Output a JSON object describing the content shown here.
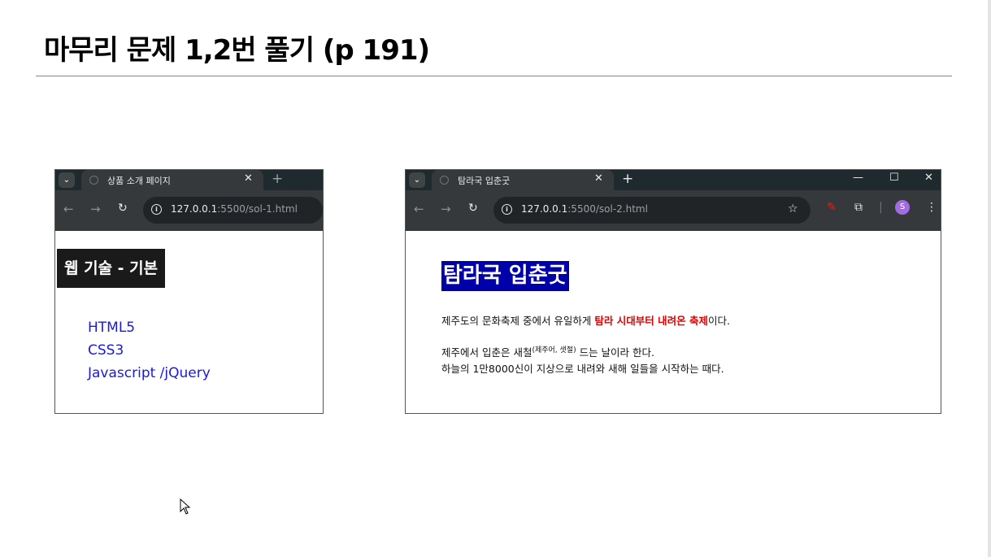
{
  "slide": {
    "title": "마무리 문제 1,2번 풀기 (p 191)"
  },
  "colors": {
    "title_rule": "#6f7fe3",
    "browser_tabbar": "#1f2a2e",
    "browser_toolbar": "#35393b",
    "heading1_bg": "#1a1a1a",
    "heading2_bg": "#0000aa",
    "link_blue": "#1a1adb",
    "emphasis_red": "#e00000"
  },
  "browser1": {
    "tab_title": "상품 소개 페이지",
    "url_host": "127.0.0.1",
    "url_path": ":5500/sol-1.html",
    "icons": {
      "tab_menu": "chevron-down-icon",
      "close": "close-icon",
      "new_tab": "plus-icon",
      "back": "arrow-left-icon",
      "forward": "arrow-right-icon",
      "reload": "reload-icon",
      "site_info": "info-icon"
    },
    "heading": "웹 기술 - 기본",
    "list": [
      "HTML5",
      "CSS3",
      "Javascript /jQuery"
    ]
  },
  "browser2": {
    "tab_title": "탐라국 입춘굿",
    "url_host": "127.0.0.1",
    "url_path": ":5500/sol-2.html",
    "profile_initial": "S",
    "icons": {
      "bookmark": "star-icon",
      "extension_pen": "pen-icon",
      "extensions": "puzzle-icon",
      "menu": "kebab-menu-icon",
      "minimize": "minimize-icon",
      "maximize": "maximize-icon",
      "close_window": "close-icon"
    },
    "heading": "탐라국 입춘굿",
    "para1": {
      "before": "제주도의 문화축제 중에서 유일하게 ",
      "emphasis": "탐라 시대부터 내려온 축제",
      "after": "이다."
    },
    "para2": {
      "line1_before": "제주에서 입춘은 새철",
      "line1_sup": "(제주어, 샛절)",
      "line1_after": " 드는 날이라 한다.",
      "line2": "하늘의 1만8000신이 지상으로 내려와 새해 일들을 시작하는 때다."
    }
  }
}
